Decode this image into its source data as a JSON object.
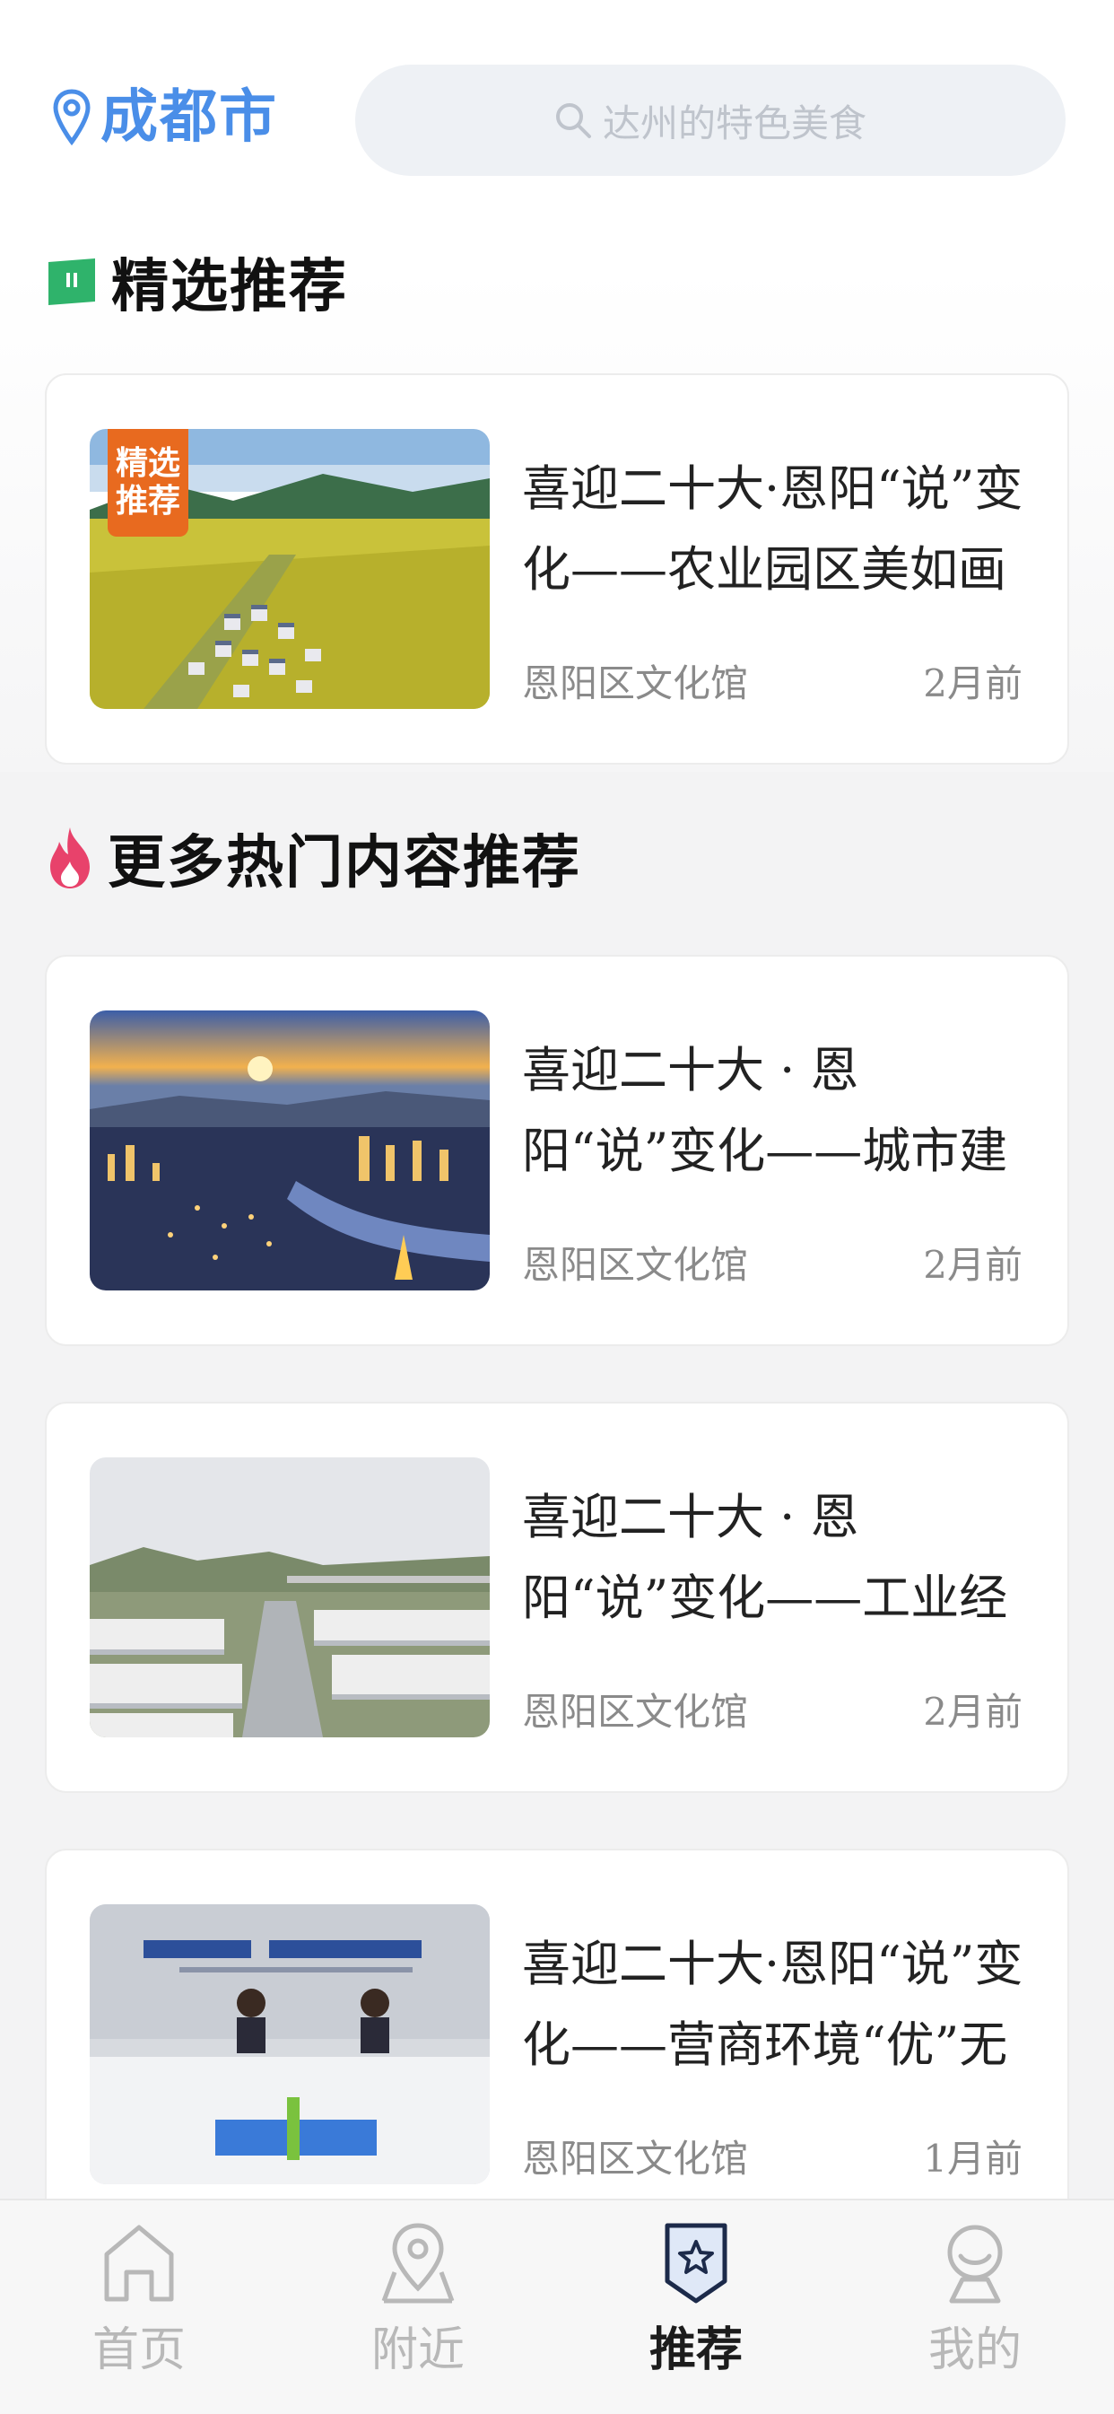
{
  "header": {
    "city": "成都市",
    "search_placeholder": "达州的特色美食"
  },
  "sections": {
    "featured_title": "精选推荐",
    "hot_title": "更多热门内容推荐"
  },
  "featured": {
    "badge_line1": "精选",
    "badge_line2": "推荐",
    "title": "喜迎二十大·恩阳“说”变化——农业园区美如画",
    "source": "恩阳区文化馆",
    "time": "2月前"
  },
  "hot_items": [
    {
      "title": "喜迎二十大 · 恩阳“说”变化——城市建",
      "source": "恩阳区文化馆",
      "time": "2月前"
    },
    {
      "title": "喜迎二十大 · 恩阳“说”变化——工业经",
      "source": "恩阳区文化馆",
      "time": "2月前"
    },
    {
      "title": "喜迎二十大·恩阳“说”变化——营商环境“优”无",
      "source": "恩阳区文化馆",
      "time": "1月前"
    }
  ],
  "tabbar": {
    "items": [
      {
        "label": "首页",
        "icon": "home-icon",
        "active": false
      },
      {
        "label": "附近",
        "icon": "map-pin-icon",
        "active": false
      },
      {
        "label": "推荐",
        "icon": "star-badge-icon",
        "active": true
      },
      {
        "label": "我的",
        "icon": "profile-icon",
        "active": false
      }
    ]
  },
  "colors": {
    "accent": "#4a8ee8",
    "badge_orange": "#e86a1f",
    "featured_icon_green": "#2fb36b",
    "flame_pink": "#e8426b",
    "text_primary": "#222222",
    "text_secondary": "#8a8a8a",
    "tab_inactive": "#b8b8b8"
  }
}
